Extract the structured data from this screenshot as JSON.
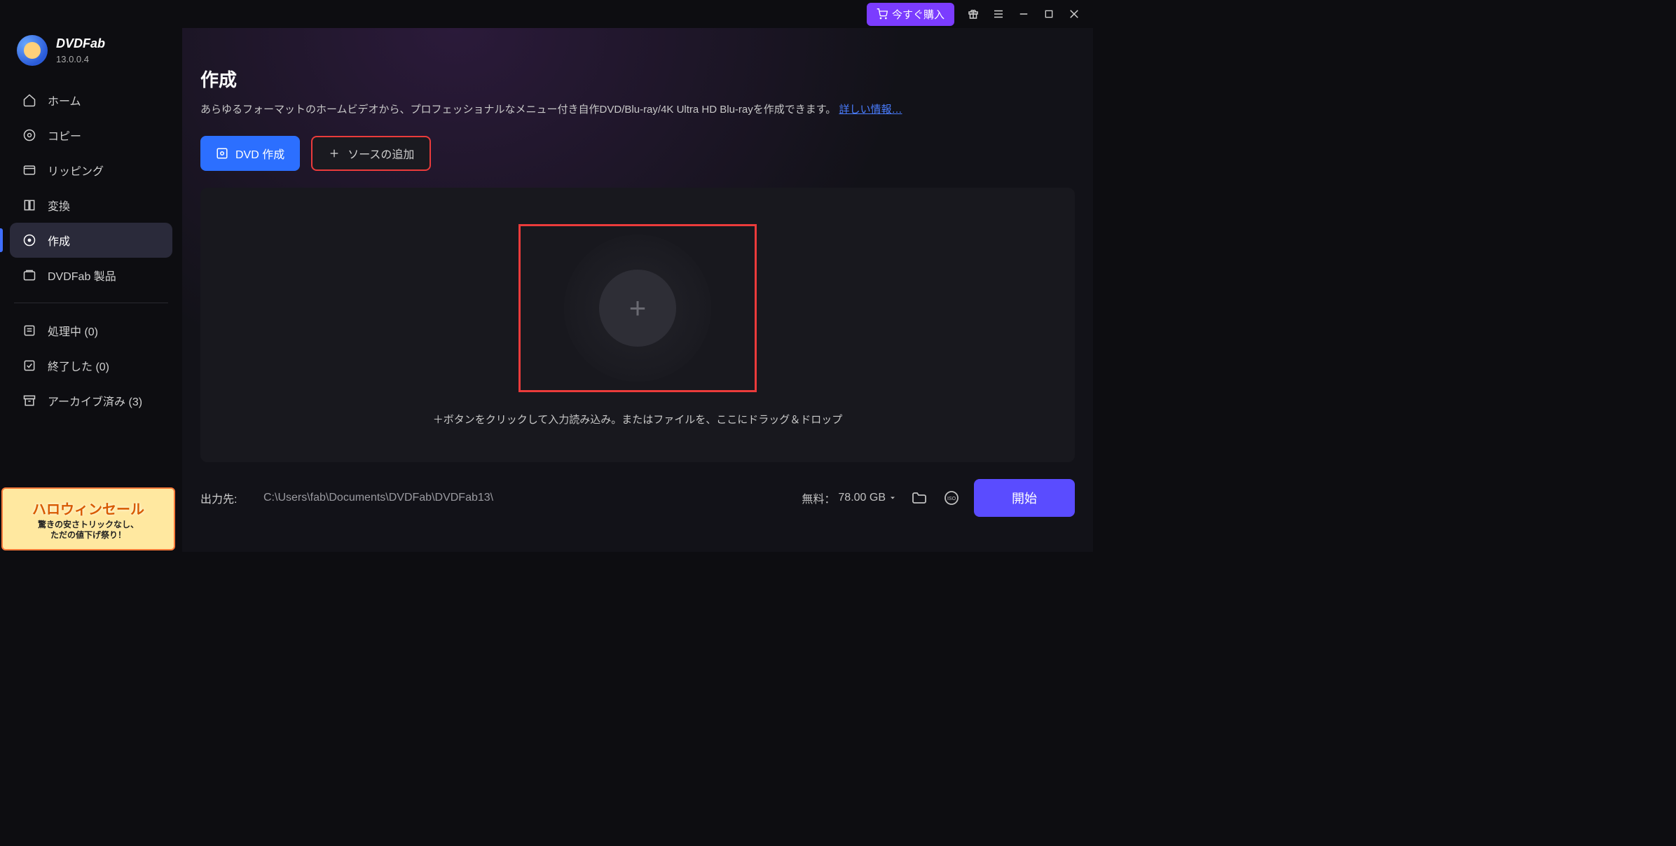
{
  "titlebar": {
    "buy_now": "今すぐ購入"
  },
  "logo": {
    "title": "DVDFab",
    "version": "13.0.0.4"
  },
  "sidebar": {
    "items": [
      {
        "label": "ホーム"
      },
      {
        "label": "コピー"
      },
      {
        "label": "リッピング"
      },
      {
        "label": "変換"
      },
      {
        "label": "作成"
      },
      {
        "label": "DVDFab 製品"
      }
    ],
    "tasks": [
      {
        "label": "処理中 (0)"
      },
      {
        "label": "終了した (0)"
      },
      {
        "label": "アーカイブ済み (3)"
      }
    ]
  },
  "promo": {
    "title": "ハロウィンセール",
    "sub1": "驚きの安さトリックなし、",
    "sub2": "ただの値下げ祭り！"
  },
  "page": {
    "title": "作成",
    "desc_prefix": "あらゆるフォーマットのホームビデオから、プロフェッショナルなメニュー付き自作DVD/Blu-ray/4K Ultra HD Blu-rayを作成できます。",
    "more_link": "詳しい情報…"
  },
  "toolbar": {
    "dvd_create": "DVD 作成",
    "add_source": "ソースの追加"
  },
  "dropzone": {
    "hint": "＋ボタンをクリックして入力読み込み。またはファイルを、ここにドラッグ＆ドロップ"
  },
  "footer": {
    "output_label": "出力先:",
    "output_path": "C:\\Users\\fab\\Documents\\DVDFab\\DVDFab13\\",
    "free_label": "無料：",
    "free_space": "78.00 GB",
    "start": "開始"
  }
}
